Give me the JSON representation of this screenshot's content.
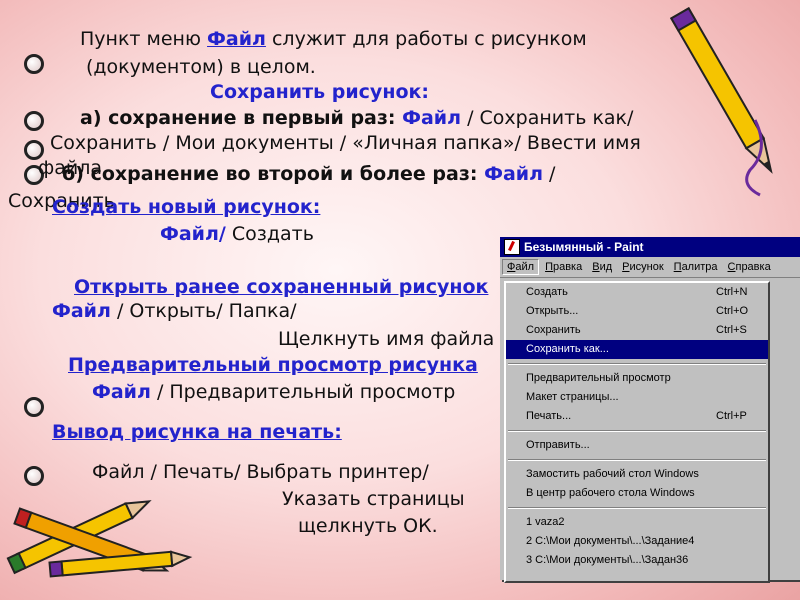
{
  "text": {
    "line1a": "Пункт меню ",
    "line1b": "Файл",
    "line1c": " служит для работы с рисунком",
    "line2": "(документом)  в целом.",
    "save_heading": "Сохранить рисунок:",
    "first_a": "а) сохранение в первый раз: ",
    "first_b": "Файл",
    "first_c": " / Сохранить как/",
    "first_line2": "Сохранить  / Мои документы / «Личная папка»/ Ввести имя",
    "first_line3": "файла",
    "second_a": "б) сохранение во второй и более раз: ",
    "second_b": "Файл",
    "second_c": " /",
    "second_line2": "Сохранить",
    "new_heading": "Создать новый рисунок:",
    "new_a": "Файл/",
    "new_b": " Создать",
    "open_heading": "Открыть ранее сохраненный рисунок",
    "open_a": "Файл",
    "open_b": " / Открыть/ Папка/",
    "open_line2": "Щелкнуть имя файла",
    "preview_heading": "Предварительный просмотр рисунка",
    "preview_a": "Файл",
    "preview_b": " / Предварительный просмотр",
    "print_heading": "Вывод  рисунка на печать:",
    "print_line1": "Файл / Печать/ Выбрать принтер/",
    "print_line2": "Указать страницы",
    "print_line3": "щелкнуть ОК."
  },
  "paint_window": {
    "title": "Безымянный - Paint",
    "menus": [
      "Файл",
      "Правка",
      "Вид",
      "Рисунок",
      "Палитра",
      "Справка"
    ],
    "items": [
      {
        "label": "Создать",
        "shortcut": "Ctrl+N"
      },
      {
        "label": "Открыть...",
        "shortcut": "Ctrl+O"
      },
      {
        "label": "Сохранить",
        "shortcut": "Ctrl+S"
      },
      {
        "label": "Сохранить как...",
        "shortcut": "",
        "selected": true
      },
      {
        "label": "Предварительный просмотр",
        "shortcut": ""
      },
      {
        "label": "Макет страницы...",
        "shortcut": ""
      },
      {
        "label": "Печать...",
        "shortcut": "Ctrl+P"
      },
      {
        "label": "Отправить...",
        "shortcut": ""
      },
      {
        "label": "Замостить рабочий стол Windows",
        "shortcut": ""
      },
      {
        "label": "В центр рабочего стола Windows",
        "shortcut": ""
      },
      {
        "label": "1 vaza2",
        "shortcut": ""
      },
      {
        "label": "2 C:\\Мои документы\\...\\Задание4",
        "shortcut": ""
      },
      {
        "label": "3 C:\\Мои документы\\...\\Задан36",
        "shortcut": ""
      }
    ]
  },
  "colors": {
    "accent_blue": "#2323cc",
    "title_bar": "#000080",
    "background": "#f2b8b8"
  }
}
